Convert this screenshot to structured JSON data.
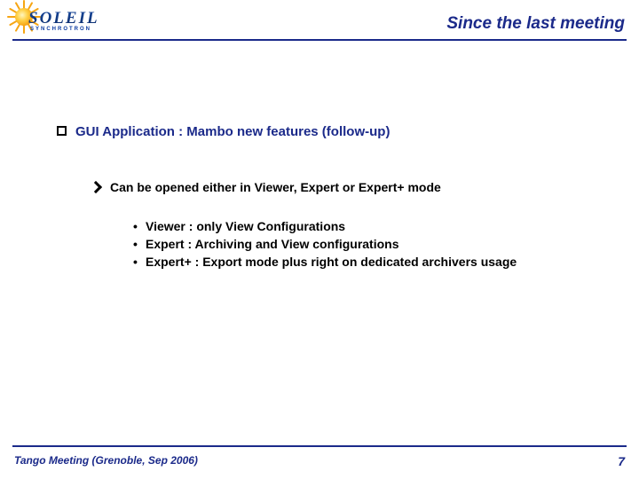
{
  "logo": {
    "word": "SOLEIL",
    "sub": "SYNCHROTRON"
  },
  "title": "Since the last meeting",
  "heading": "GUI Application : Mambo new features (follow-up)",
  "arrow_item": "Can be opened either in Viewer, Expert or Expert+ mode",
  "sub_items": [
    "Viewer : only View Configurations",
    "Expert : Archiving and View configurations",
    "Expert+ : Export mode plus right on dedicated archivers usage"
  ],
  "footer": {
    "left": "Tango Meeting (Grenoble, Sep 2006)",
    "page": "7"
  }
}
